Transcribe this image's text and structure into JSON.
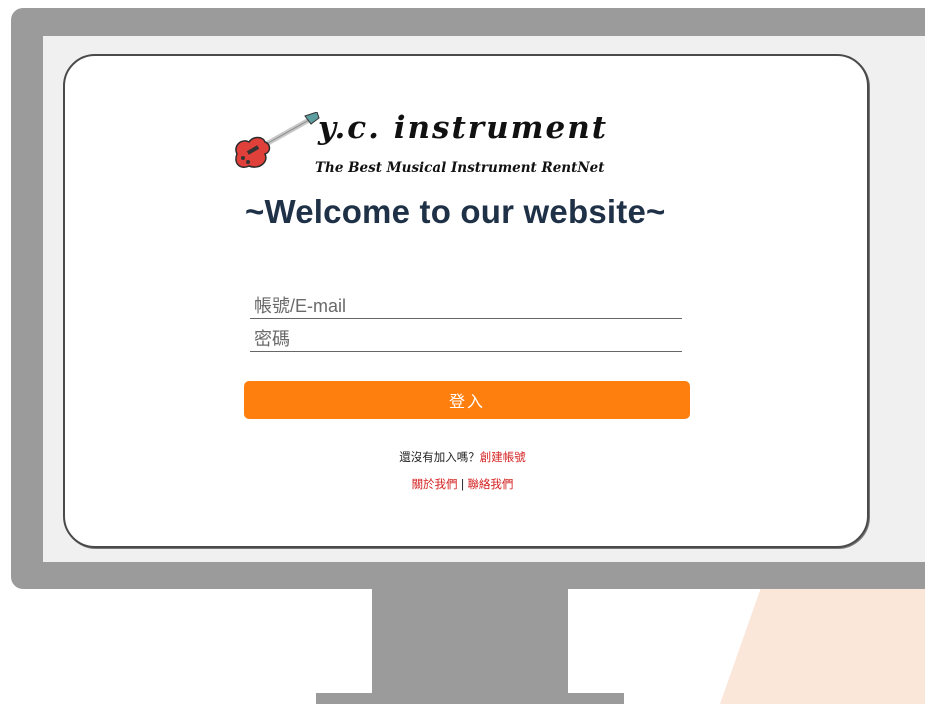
{
  "brand": {
    "name": "y.c. instrument",
    "tagline": "The Best Musical Instrument RentNet"
  },
  "welcome": "~Welcome to our website~",
  "login": {
    "account_placeholder": "帳號/E-mail",
    "password_placeholder": "密碼",
    "button_label": "登入"
  },
  "signup": {
    "prompt": "還沒有加入嗎？",
    "link_label": "創建帳號"
  },
  "footer_links": {
    "about": "關於我們",
    "separator": "|",
    "contact": "聯絡我們"
  },
  "colors": {
    "accent": "#ff7f0e",
    "link": "#d42020",
    "title": "#1f3147",
    "monitor": "#9b9b9b"
  },
  "icons": {
    "logo": "electric-guitar-icon"
  }
}
